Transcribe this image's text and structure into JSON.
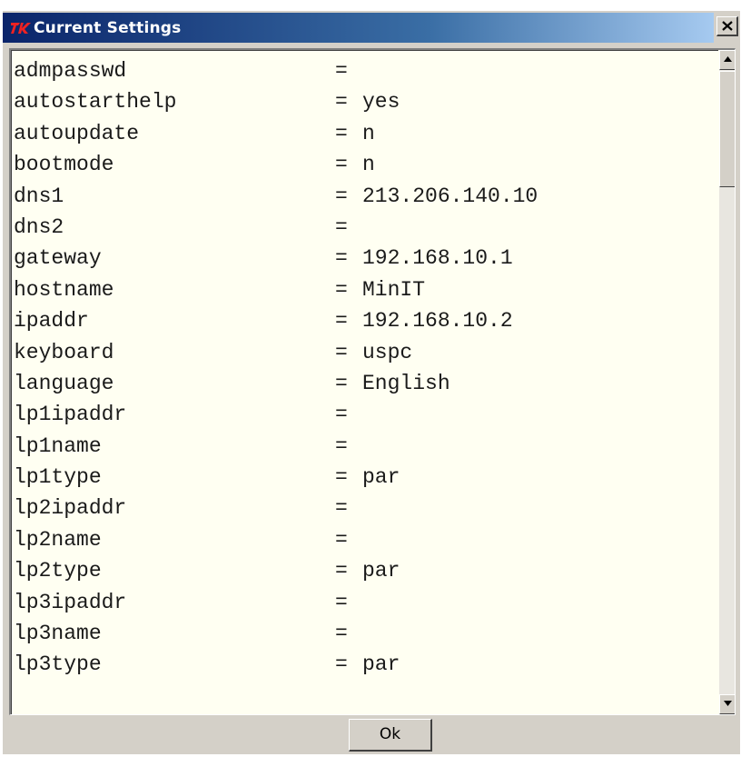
{
  "window": {
    "title": "Current Settings",
    "icon": "tk-feather-icon",
    "close_icon": "close-icon"
  },
  "settings": [
    {
      "key": "admpasswd",
      "value": ""
    },
    {
      "key": "autostarthelp",
      "value": "yes"
    },
    {
      "key": "autoupdate",
      "value": "n"
    },
    {
      "key": "bootmode",
      "value": "n"
    },
    {
      "key": "dns1",
      "value": "213.206.140.10"
    },
    {
      "key": "dns2",
      "value": ""
    },
    {
      "key": "gateway",
      "value": "192.168.10.1"
    },
    {
      "key": "hostname",
      "value": "MinIT"
    },
    {
      "key": "ipaddr",
      "value": "192.168.10.2"
    },
    {
      "key": "keyboard",
      "value": "uspc"
    },
    {
      "key": "language",
      "value": "English"
    },
    {
      "key": "lp1ipaddr",
      "value": ""
    },
    {
      "key": "lp1name",
      "value": ""
    },
    {
      "key": "lp1type",
      "value": "par"
    },
    {
      "key": "lp2ipaddr",
      "value": ""
    },
    {
      "key": "lp2name",
      "value": ""
    },
    {
      "key": "lp2type",
      "value": "par"
    },
    {
      "key": "lp3ipaddr",
      "value": ""
    },
    {
      "key": "lp3name",
      "value": ""
    },
    {
      "key": "lp3type",
      "value": "par"
    }
  ],
  "separator": "=",
  "buttons": {
    "ok_label": "Ok"
  },
  "colors": {
    "title_start": "#0a246a",
    "title_end": "#a6caf0",
    "text_bg": "#fffff2",
    "face": "#d4d0c8"
  }
}
